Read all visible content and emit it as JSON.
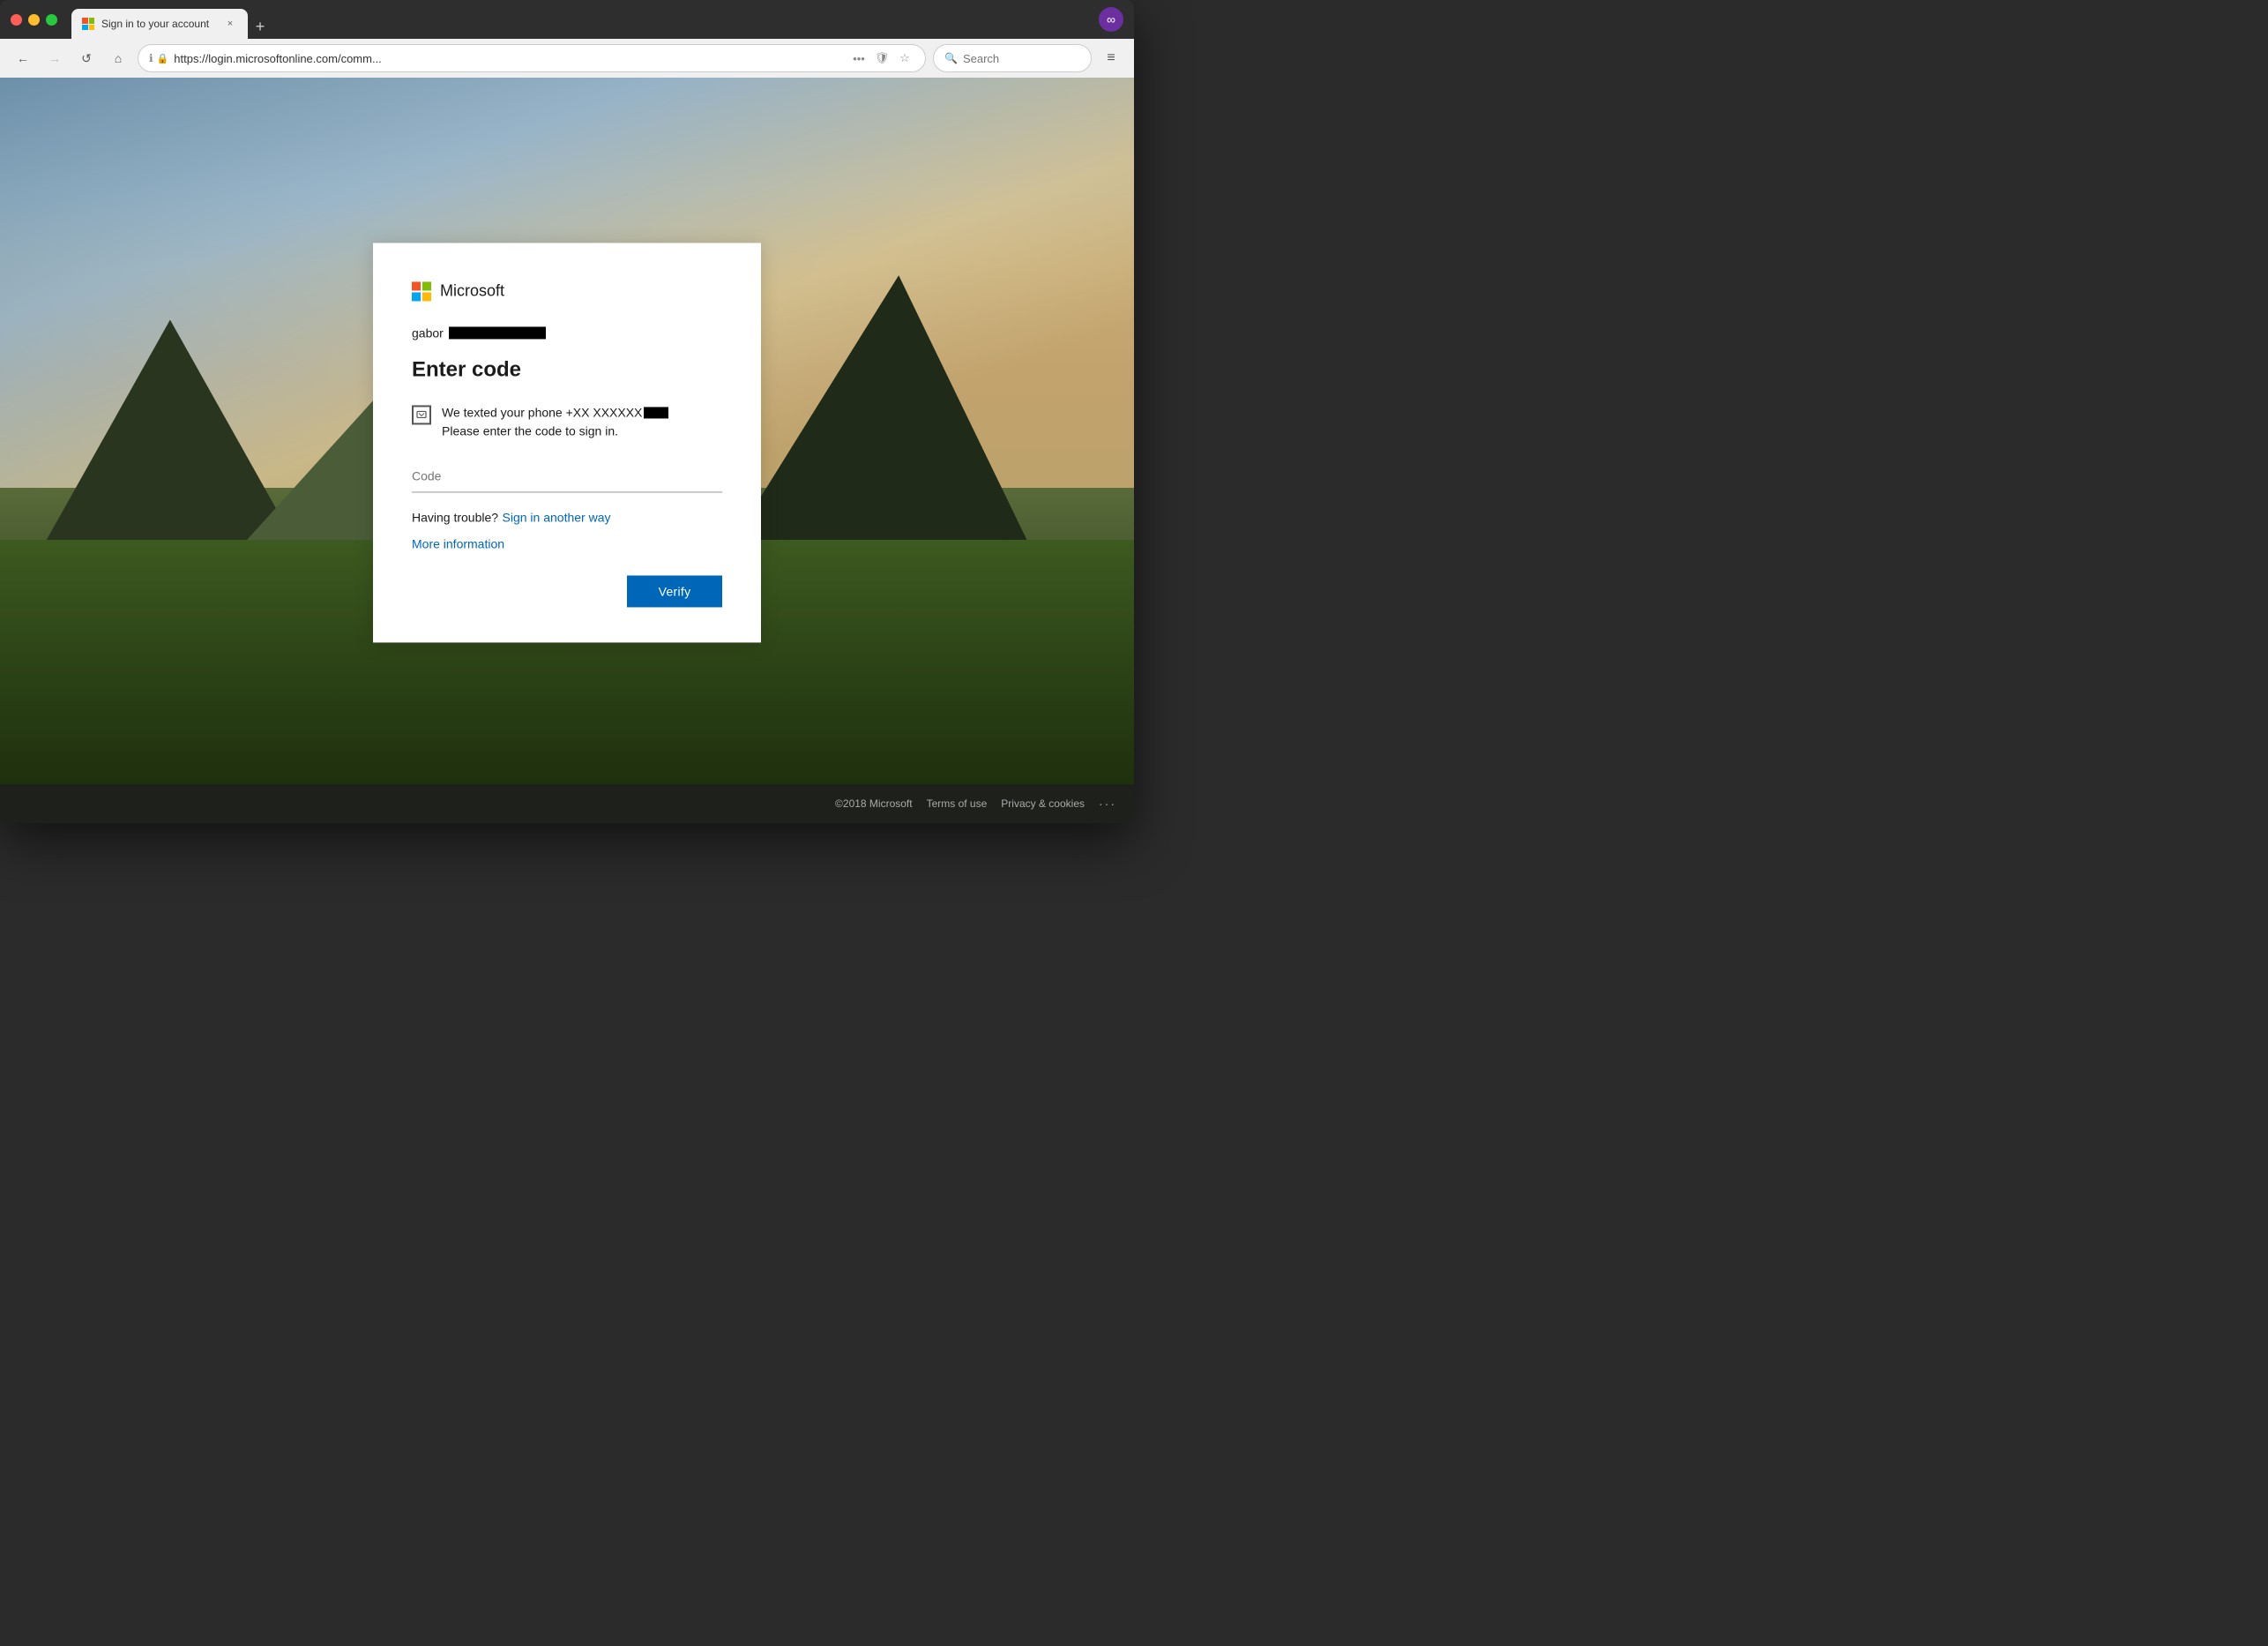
{
  "browser": {
    "tab": {
      "favicon_label": "Microsoft favicon",
      "title": "Sign in to your account",
      "close_label": "×"
    },
    "new_tab_label": "+",
    "ext_icon_label": "∞",
    "nav": {
      "back_label": "←",
      "forward_label": "→",
      "refresh_label": "↺",
      "home_label": "⌂",
      "url": "https://login.microsoftonline.com/comm...",
      "more_label": "•••",
      "shield_label": "🛡",
      "star_label": "☆",
      "search_placeholder": "Search",
      "menu_label": "≡"
    }
  },
  "page": {
    "footer": {
      "copyright": "©2018 Microsoft",
      "terms_label": "Terms of use",
      "privacy_label": "Privacy & cookies",
      "more_label": "···"
    }
  },
  "card": {
    "brand_name": "Microsoft",
    "user_email_prefix": "gabor",
    "title": "Enter code",
    "sms_message_prefix": "We texted your phone +XX XXXXXX",
    "sms_message_suffix": "Please enter the code to sign in.",
    "code_placeholder": "Code",
    "trouble_text": "Having trouble?",
    "sign_in_another_way_label": "Sign in another way",
    "more_info_label": "More information",
    "verify_label": "Verify"
  }
}
